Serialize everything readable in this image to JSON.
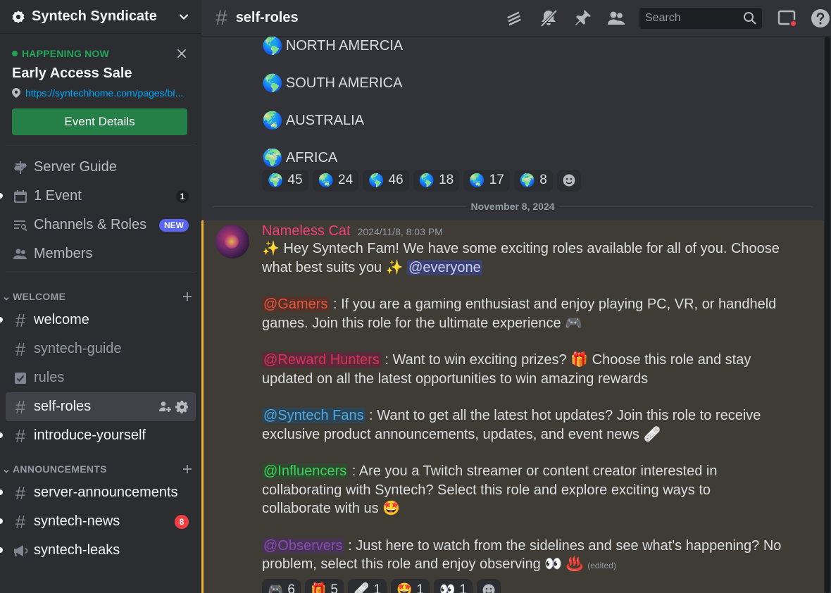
{
  "server": {
    "name": "Syntech Syndicate"
  },
  "event": {
    "status": "HAPPENING NOW",
    "title": "Early Access Sale",
    "link": "https://syntechhome.com/pages/bl...",
    "button": "Event Details"
  },
  "nav": [
    {
      "label": "Server Guide",
      "icon": "signpost-icon"
    },
    {
      "label": "1 Event",
      "icon": "calendar-icon",
      "badge": "1"
    },
    {
      "label": "Channels & Roles",
      "icon": "browse-channels-icon",
      "badge": "NEW"
    },
    {
      "label": "Members",
      "icon": "members-icon"
    }
  ],
  "categories": {
    "welcome": "WELCOME",
    "announcements": "ANNOUNCEMENTS"
  },
  "channels": {
    "welcome": "welcome",
    "syntech_guide": "syntech-guide",
    "rules": "rules",
    "self_roles": "self-roles",
    "introduce": "introduce-yourself",
    "server_ann": "server-announcements",
    "news": "syntech-news",
    "news_badge": "8",
    "leaks": "syntech-leaks"
  },
  "header": {
    "channel": "self-roles",
    "search_placeholder": "Search"
  },
  "prev_message": {
    "regions": [
      {
        "emoji": "🌎",
        "label": "NORTH AMERCIA"
      },
      {
        "emoji": "🌎",
        "label": "SOUTH AMERICA"
      },
      {
        "emoji": "🌏",
        "label": "AUSTRALIA"
      },
      {
        "emoji": "🌍",
        "label": "AFRICA"
      }
    ],
    "reactions": [
      {
        "emoji": "🌍",
        "count": "45"
      },
      {
        "emoji": "🌏",
        "count": "24"
      },
      {
        "emoji": "🌎",
        "count": "46"
      },
      {
        "emoji": "🌎",
        "count": "18"
      },
      {
        "emoji": "🌏",
        "count": "17"
      },
      {
        "emoji": "🌍",
        "count": "8"
      }
    ]
  },
  "date_divider": "November 8, 2024",
  "message": {
    "author": "Nameless Cat",
    "timestamp": "2024/11/8, 8:03 PM",
    "intro_a": "✨ Hey Syntech Fam! We have some exciting roles available for all of you. Choose what best suits you ✨ ",
    "everyone": "@everyone",
    "gamers": "@Gamers",
    "gamers_text": " : If you are a gaming enthusiast and enjoy playing PC, VR, or handheld games. Join this role for the ultimate experience 🎮",
    "reward": "@Reward Hunters",
    "reward_text": " : Want to win exciting prizes? 🎁 Choose this role and stay updated on all the latest opportunities to win amazing rewards",
    "fans": "@Syntech Fans",
    "fans_text": " : Want to get all the latest hot updates? Join this role to receive exclusive product announcements, updates, and event news 🩹",
    "influencers": "@Influencers",
    "influencers_text": " : Are you a Twitch streamer or content creator interested in collaborating with Syntech? Select this role and explore exciting ways to collaborate with us 🤩",
    "observers": "@Observers",
    "observers_text": " : Just here to watch from the sidelines and see what's happening? No problem, select this role and enjoy observing 👀 ♨️ ",
    "edited": "(edited)",
    "reactions": [
      {
        "emoji": "🎮",
        "count": "6"
      },
      {
        "emoji": "🎁",
        "count": "5"
      },
      {
        "emoji": "🩹",
        "count": "1"
      },
      {
        "emoji": "🤩",
        "count": "1"
      },
      {
        "emoji": "👀",
        "count": "1"
      }
    ]
  },
  "colors": {
    "accent_green": "#23a55a",
    "brand_blurple": "#5865f2",
    "mention_highlight": "#f0b232",
    "notification_red": "#f23f43"
  }
}
